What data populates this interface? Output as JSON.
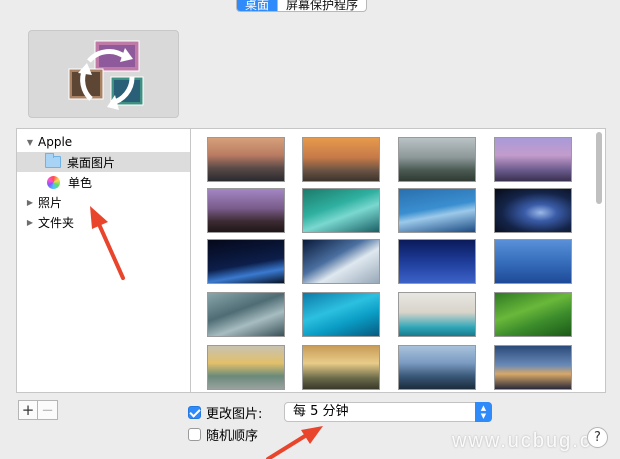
{
  "tabs": [
    {
      "label": "桌面",
      "active": true
    },
    {
      "label": "屏幕保护程序",
      "active": false
    }
  ],
  "sidebar": {
    "items": [
      {
        "label": "Apple",
        "expanded": true,
        "icon": "disclosure-open"
      },
      {
        "label": "桌面图片",
        "selected": true,
        "icon": "folder-icon"
      },
      {
        "label": "单色",
        "icon": "color-wheel-icon"
      },
      {
        "label": "照片",
        "expanded": false,
        "icon": "disclosure-closed"
      },
      {
        "label": "文件夹",
        "expanded": false,
        "icon": "disclosure-closed"
      }
    ]
  },
  "toolbar": {
    "add_label": "+",
    "remove_label": "−"
  },
  "options": {
    "change_picture_label": "更改图片:",
    "change_picture_checked": true,
    "interval_value": "每 5 分钟",
    "random_order_label": "随机顺序",
    "random_order_checked": false
  },
  "help_label": "?",
  "watermark": "www.ucbug.cc",
  "colors": {
    "accent": "#2f8bfa",
    "arrow": "#e8452c"
  }
}
